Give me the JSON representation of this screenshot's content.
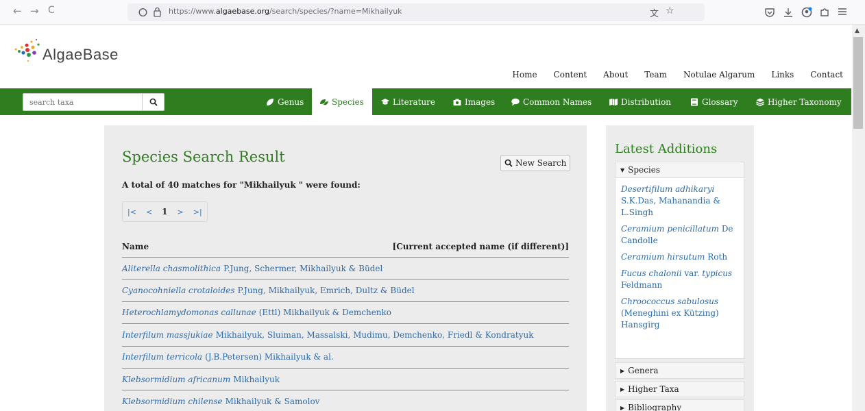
{
  "browser": {
    "back": "←",
    "forward": "→",
    "reload": "C",
    "url_prefix": "https://www.",
    "url_domain": "algaebase.org",
    "url_path": "/search/species/?name=Mikhailyuk"
  },
  "site": {
    "logo_text": "AlgaeBase",
    "top_nav": [
      "Home",
      "Content",
      "About",
      "Team",
      "Notulae Algarum",
      "Links",
      "Contact"
    ],
    "search_placeholder": "search taxa",
    "tabs": {
      "genus": "Genus",
      "species": "Species",
      "literature": "Literature",
      "images": "Images",
      "common_names": "Common Names",
      "distribution": "Distribution",
      "glossary": "Glossary",
      "higher_taxonomy": "Higher Taxonomy"
    },
    "colors": {
      "brand_green": "#2e7d1f",
      "link_blue": "#2c6aa9"
    }
  },
  "results": {
    "title": "Species Search Result",
    "new_search_label": "New Search",
    "summary": "A total of 40 matches for \"Mikhailyuk \" were found:",
    "pager": {
      "first": "|<",
      "prev": "<",
      "current": "1",
      "next": ">",
      "last": ">|"
    },
    "col_name": "Name",
    "col_accepted": "[Current accepted name (if different)]",
    "rows": [
      {
        "species": "Aliterella chasmolithica",
        "authority": "P.Jung, Schermer, Mikhailyuk & Büdel"
      },
      {
        "species": "Cyanocohniella crotaloides",
        "authority": "P.Jung, Mikhailyuk, Emrich, Dultz & Büdel"
      },
      {
        "species": "Heterochlamydomonas callunae",
        "authority": "(Ettl) Mikhailyuk & Demchenko"
      },
      {
        "species": "Interfilum massjukiae",
        "authority": "Mikhailyuk, Sluiman, Massalski, Mudimu, Demchenko, Friedl & Kondratyuk"
      },
      {
        "species": "Interfilum terricola",
        "authority": "(J.B.Petersen) Mikhailyuk & al."
      },
      {
        "species": "Klebsormidium africanum",
        "authority": "Mikhailyuk"
      },
      {
        "species": "Klebsormidium chilense",
        "authority": "Mikhailyuk & Samolov"
      }
    ]
  },
  "sidebar": {
    "title": "Latest Additions",
    "species_header": "Species",
    "latest": [
      {
        "species": "Desertifilum adhikaryi",
        "authority": "S.K.Das, Mahanandia & L.Singh"
      },
      {
        "species": "Ceramium penicillatum",
        "authority": "De Candolle"
      },
      {
        "species": "Ceramium hirsutum",
        "authority": "Roth"
      },
      {
        "species": "Fucus chalonii",
        "authority": "var. ",
        "species2": "typicus",
        "authority2": "Feldmann"
      },
      {
        "species": "Chroococcus sabulosus",
        "authority": "(Meneghini ex Kützing) Hansgirg"
      }
    ],
    "genera_header": "Genera",
    "higher_taxa_header": "Higher Taxa",
    "bibliography_header": "Bibliography"
  }
}
